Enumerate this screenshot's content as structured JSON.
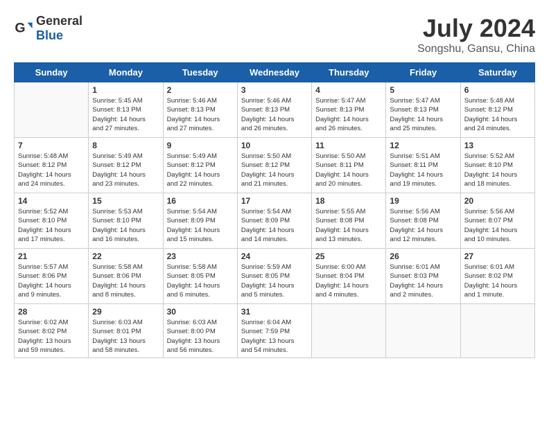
{
  "header": {
    "logo_general": "General",
    "logo_blue": "Blue",
    "month_year": "July 2024",
    "location": "Songshu, Gansu, China"
  },
  "days_of_week": [
    "Sunday",
    "Monday",
    "Tuesday",
    "Wednesday",
    "Thursday",
    "Friday",
    "Saturday"
  ],
  "weeks": [
    [
      {
        "date": "",
        "content": ""
      },
      {
        "date": "1",
        "content": "Sunrise: 5:45 AM\nSunset: 8:13 PM\nDaylight: 14 hours\nand 27 minutes."
      },
      {
        "date": "2",
        "content": "Sunrise: 5:46 AM\nSunset: 8:13 PM\nDaylight: 14 hours\nand 27 minutes."
      },
      {
        "date": "3",
        "content": "Sunrise: 5:46 AM\nSunset: 8:13 PM\nDaylight: 14 hours\nand 26 minutes."
      },
      {
        "date": "4",
        "content": "Sunrise: 5:47 AM\nSunset: 8:13 PM\nDaylight: 14 hours\nand 26 minutes."
      },
      {
        "date": "5",
        "content": "Sunrise: 5:47 AM\nSunset: 8:13 PM\nDaylight: 14 hours\nand 25 minutes."
      },
      {
        "date": "6",
        "content": "Sunrise: 5:48 AM\nSunset: 8:12 PM\nDaylight: 14 hours\nand 24 minutes."
      }
    ],
    [
      {
        "date": "7",
        "content": "Sunrise: 5:48 AM\nSunset: 8:12 PM\nDaylight: 14 hours\nand 24 minutes."
      },
      {
        "date": "8",
        "content": "Sunrise: 5:49 AM\nSunset: 8:12 PM\nDaylight: 14 hours\nand 23 minutes."
      },
      {
        "date": "9",
        "content": "Sunrise: 5:49 AM\nSunset: 8:12 PM\nDaylight: 14 hours\nand 22 minutes."
      },
      {
        "date": "10",
        "content": "Sunrise: 5:50 AM\nSunset: 8:12 PM\nDaylight: 14 hours\nand 21 minutes."
      },
      {
        "date": "11",
        "content": "Sunrise: 5:50 AM\nSunset: 8:11 PM\nDaylight: 14 hours\nand 20 minutes."
      },
      {
        "date": "12",
        "content": "Sunrise: 5:51 AM\nSunset: 8:11 PM\nDaylight: 14 hours\nand 19 minutes."
      },
      {
        "date": "13",
        "content": "Sunrise: 5:52 AM\nSunset: 8:10 PM\nDaylight: 14 hours\nand 18 minutes."
      }
    ],
    [
      {
        "date": "14",
        "content": "Sunrise: 5:52 AM\nSunset: 8:10 PM\nDaylight: 14 hours\nand 17 minutes."
      },
      {
        "date": "15",
        "content": "Sunrise: 5:53 AM\nSunset: 8:10 PM\nDaylight: 14 hours\nand 16 minutes."
      },
      {
        "date": "16",
        "content": "Sunrise: 5:54 AM\nSunset: 8:09 PM\nDaylight: 14 hours\nand 15 minutes."
      },
      {
        "date": "17",
        "content": "Sunrise: 5:54 AM\nSunset: 8:09 PM\nDaylight: 14 hours\nand 14 minutes."
      },
      {
        "date": "18",
        "content": "Sunrise: 5:55 AM\nSunset: 8:08 PM\nDaylight: 14 hours\nand 13 minutes."
      },
      {
        "date": "19",
        "content": "Sunrise: 5:56 AM\nSunset: 8:08 PM\nDaylight: 14 hours\nand 12 minutes."
      },
      {
        "date": "20",
        "content": "Sunrise: 5:56 AM\nSunset: 8:07 PM\nDaylight: 14 hours\nand 10 minutes."
      }
    ],
    [
      {
        "date": "21",
        "content": "Sunrise: 5:57 AM\nSunset: 8:06 PM\nDaylight: 14 hours\nand 9 minutes."
      },
      {
        "date": "22",
        "content": "Sunrise: 5:58 AM\nSunset: 8:06 PM\nDaylight: 14 hours\nand 8 minutes."
      },
      {
        "date": "23",
        "content": "Sunrise: 5:58 AM\nSunset: 8:05 PM\nDaylight: 14 hours\nand 6 minutes."
      },
      {
        "date": "24",
        "content": "Sunrise: 5:59 AM\nSunset: 8:05 PM\nDaylight: 14 hours\nand 5 minutes."
      },
      {
        "date": "25",
        "content": "Sunrise: 6:00 AM\nSunset: 8:04 PM\nDaylight: 14 hours\nand 4 minutes."
      },
      {
        "date": "26",
        "content": "Sunrise: 6:01 AM\nSunset: 8:03 PM\nDaylight: 14 hours\nand 2 minutes."
      },
      {
        "date": "27",
        "content": "Sunrise: 6:01 AM\nSunset: 8:02 PM\nDaylight: 14 hours\nand 1 minute."
      }
    ],
    [
      {
        "date": "28",
        "content": "Sunrise: 6:02 AM\nSunset: 8:02 PM\nDaylight: 13 hours\nand 59 minutes."
      },
      {
        "date": "29",
        "content": "Sunrise: 6:03 AM\nSunset: 8:01 PM\nDaylight: 13 hours\nand 58 minutes."
      },
      {
        "date": "30",
        "content": "Sunrise: 6:03 AM\nSunset: 8:00 PM\nDaylight: 13 hours\nand 56 minutes."
      },
      {
        "date": "31",
        "content": "Sunrise: 6:04 AM\nSunset: 7:59 PM\nDaylight: 13 hours\nand 54 minutes."
      },
      {
        "date": "",
        "content": ""
      },
      {
        "date": "",
        "content": ""
      },
      {
        "date": "",
        "content": ""
      }
    ]
  ]
}
